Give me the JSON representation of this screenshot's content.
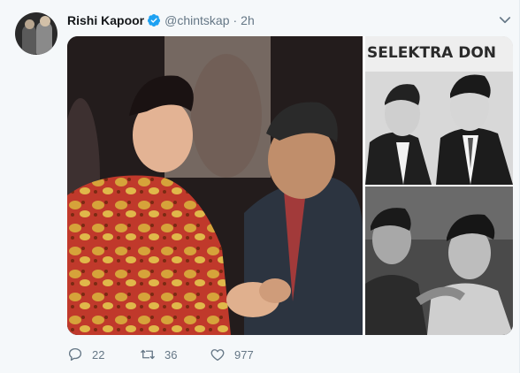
{
  "tweet": {
    "display_name": "Rishi Kapoor",
    "handle": "@chintskap",
    "separator": "·",
    "time": "2h",
    "verified": true
  },
  "media": {
    "photos": [
      {
        "name": "main-photo"
      },
      {
        "name": "top-right-photo",
        "banner_text": "SELEKTRA DON"
      },
      {
        "name": "bottom-right-photo"
      }
    ]
  },
  "actions": {
    "reply_count": "22",
    "retweet_count": "36",
    "like_count": "977"
  },
  "icons": {
    "verified": "verified-badge-icon",
    "caret": "chevron-down-icon",
    "reply": "reply-icon",
    "retweet": "retweet-icon",
    "like": "heart-icon"
  },
  "colors": {
    "verified_blue": "#1da1f2",
    "muted_text": "#657786",
    "background": "#f5f8fa"
  }
}
